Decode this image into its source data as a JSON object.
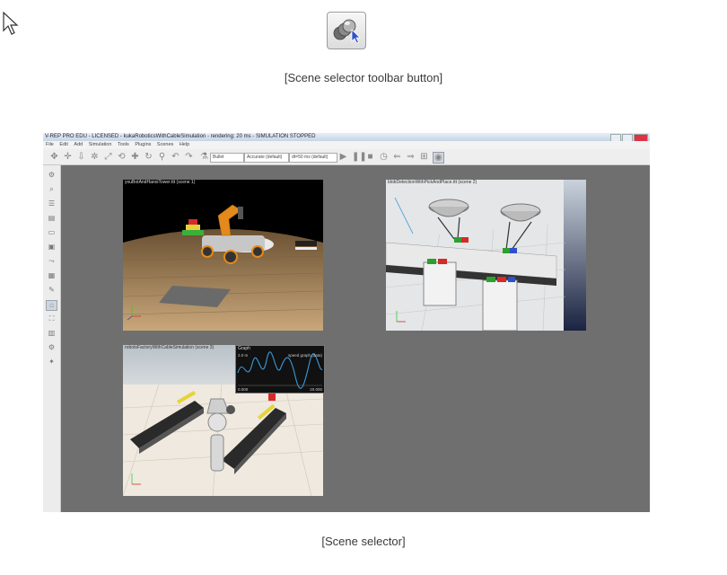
{
  "captions": {
    "toolbar_button": "[Scene selector toolbar button]",
    "scene_selector": "[Scene selector]"
  },
  "app": {
    "title": "V-REP PRO EDU - LICENSED - kukaRoboticsWithCableSimulation - rendering: 20 ms - SIMULATION STOPPED",
    "menu": [
      "File",
      "Edit",
      "Add",
      "Simulation",
      "Tools",
      "Plugins",
      "Scenes",
      "Help"
    ],
    "toolbar": {
      "camera_select": "Bullet",
      "engine_select": "Accurate (default)",
      "dt_select": "dt=50 ms (default)"
    },
    "scenes": [
      {
        "label": "youBotAndHanoiTower.ttt (scene 1)"
      },
      {
        "label": "blobDetectionWithPickAndPlace.ttt (scene 2)"
      },
      {
        "label": "robotsFactoryWithCableSimulation (scene 3)"
      }
    ],
    "graph": {
      "title": "Graph",
      "y_top": "2.0 m",
      "legend": "speed graph (data)",
      "x_left": "0.000",
      "x_right": "20.000"
    }
  },
  "colors": {
    "background": "#ffffff",
    "app_gray": "#6f6f6f",
    "graph_line": "#3a9ad9"
  }
}
